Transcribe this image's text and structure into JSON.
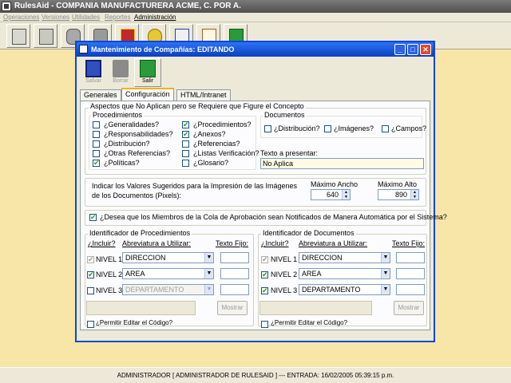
{
  "app": {
    "title": "RulesAid - COMPANIA MANUFACTURERA ACME, C. POR A.",
    "menu": [
      {
        "label": "Operaciones",
        "enabled": false
      },
      {
        "label": "Versiones",
        "enabled": false
      },
      {
        "label": "Utilidades",
        "enabled": false
      },
      {
        "label": "Reportes",
        "enabled": false
      },
      {
        "label": "Administración",
        "enabled": true
      }
    ],
    "toolbar_icons": [
      "form-icon",
      "document-icon",
      "stamp-icon",
      "jar-icon",
      "gift-icon",
      "coins-icon",
      "edit-icon",
      "signature-icon",
      "exit-door-icon"
    ],
    "status": "ADMINISTRADOR [ ADMINISTRADOR DE RULESAID ] --- ENTRADA:  16/02/2005 05:39:15 p.m."
  },
  "dialog": {
    "title": "Mantenimiento de Compañías: EDITANDO",
    "window_buttons": [
      "_",
      "□",
      "✕"
    ],
    "tools": [
      {
        "label": "Salvar",
        "icon": "floppy-disk-icon",
        "enabled": false
      },
      {
        "label": "Borrar",
        "icon": "trash-can-icon",
        "enabled": false
      },
      {
        "label": "Salir",
        "icon": "exit-door-icon",
        "enabled": true
      }
    ],
    "tabs": [
      {
        "label": "Generales",
        "selected": false
      },
      {
        "label": "Configuración",
        "selected": true
      },
      {
        "label": "HTML/Intranet",
        "selected": false
      }
    ],
    "aspectos": {
      "legend": "Aspectos que No Aplican pero se Requiere que Figure el Concepto",
      "procedimientos": {
        "legend": "Procedimientos",
        "col1": [
          {
            "label": "¿Generalidades?",
            "checked": false
          },
          {
            "label": "¿Responsabilidades?",
            "checked": false
          },
          {
            "label": "¿Distribución?",
            "checked": false
          },
          {
            "label": "¿Otras Referencias?",
            "checked": false
          },
          {
            "label": "¿Políticas?",
            "checked": true
          }
        ],
        "col2": [
          {
            "label": "¿Procedimientos?",
            "checked": true
          },
          {
            "label": "¿Anexos?",
            "checked": true
          },
          {
            "label": "¿Referencias?",
            "checked": false
          },
          {
            "label": "¿Listas Verificación?",
            "checked": false
          },
          {
            "label": "¿Glosario?",
            "checked": false
          }
        ]
      },
      "documentos": {
        "legend": "Documentos",
        "items": [
          {
            "label": "¿Distribución?",
            "checked": false
          },
          {
            "label": "¿Imágenes?",
            "checked": false
          },
          {
            "label": "¿Campos?",
            "checked": false
          }
        ]
      },
      "texto_label": "Texto a presentar:",
      "texto_value": "No Aplica"
    },
    "imagenes": {
      "text_line1": "Indicar los Valores Sugeridos para la Impresión de las Imágenes",
      "text_line2": "de los Documentos (Pixels):",
      "ancho_label": "Máximo Ancho",
      "ancho_value": "640",
      "alto_label": "Máximo Alto",
      "alto_value": "890"
    },
    "notificar": {
      "label": "¿Desea que los Miembros de la Cola de Aprobación sean Notificados de Manera Automática por el Sistema?",
      "checked": true
    },
    "id_procedimientos": {
      "legend": "Identificador de Procedimientos",
      "col_incluir": "¿Incluir?",
      "col_abrev": "Abreviatura a Utilizar:",
      "col_fijo": "Texto Fijo:",
      "rows": [
        {
          "level": "NIVEL 1",
          "checked": true,
          "check_enabled": false,
          "value": "DIRECCION",
          "enabled": true,
          "fijo": ""
        },
        {
          "level": "NIVEL 2",
          "checked": true,
          "check_enabled": true,
          "value": "AREA",
          "enabled": true,
          "fijo": ""
        },
        {
          "level": "NIVEL 3",
          "checked": false,
          "check_enabled": true,
          "value": "DEPARTAMENTO",
          "enabled": false,
          "fijo": ""
        }
      ],
      "mostrar": "Mostrar",
      "permitir": "¿Permitir Editar el Código?",
      "permitir_checked": false
    },
    "id_documentos": {
      "legend": "Identificador de Documentos",
      "col_incluir": "¿Incluir?",
      "col_abrev": "Abreviatura a Utilizar:",
      "col_fijo": "Texto Fijo:",
      "rows": [
        {
          "level": "NIVEL 1",
          "checked": true,
          "check_enabled": false,
          "value": "DIRECCION",
          "enabled": true,
          "fijo": ""
        },
        {
          "level": "NIVEL 2",
          "checked": true,
          "check_enabled": true,
          "value": "AREA",
          "enabled": true,
          "fijo": ""
        },
        {
          "level": "NIVEL 3",
          "checked": true,
          "check_enabled": true,
          "value": "DEPARTAMENTO",
          "enabled": true,
          "fijo": ""
        }
      ],
      "mostrar": "Mostrar",
      "permitir": "¿Permitir Editar el Código?",
      "permitir_checked": false
    }
  }
}
